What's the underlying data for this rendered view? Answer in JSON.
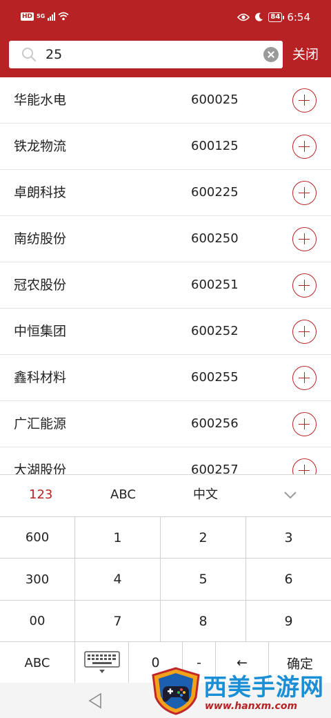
{
  "status_bar": {
    "hd_badge": "HD",
    "network": "5G",
    "battery": "84",
    "time": "6:54"
  },
  "search": {
    "value": "25",
    "placeholder": "",
    "close_label": "关闭"
  },
  "results": [
    {
      "name": "华能水电",
      "code": "600025"
    },
    {
      "name": "铁龙物流",
      "code": "600125"
    },
    {
      "name": "卓朗科技",
      "code": "600225"
    },
    {
      "name": "南纺股份",
      "code": "600250"
    },
    {
      "name": "冠农股份",
      "code": "600251"
    },
    {
      "name": "中恒集团",
      "code": "600252"
    },
    {
      "name": "鑫科材料",
      "code": "600255"
    },
    {
      "name": "广汇能源",
      "code": "600256"
    },
    {
      "name": "大湖股份",
      "code": "600257"
    }
  ],
  "keyboard": {
    "tabs": [
      "123",
      "ABC",
      "中文"
    ],
    "active_tab": "123",
    "keys": {
      "k600": "600",
      "k300": "300",
      "k00": "00",
      "kabc": "ABC",
      "k1": "1",
      "k2": "2",
      "k3": "3",
      "k4": "4",
      "k5": "5",
      "k6": "6",
      "k7": "7",
      "k8": "8",
      "k9": "9",
      "k0": "0",
      "kdash": "-",
      "kback": "←",
      "kconfirm": "确定"
    }
  },
  "watermark": {
    "title": "西美手游网",
    "url": "www.hanxm.com"
  },
  "colors": {
    "brand_red": "#b72324",
    "watermark_blue": "#1a8fd6"
  }
}
